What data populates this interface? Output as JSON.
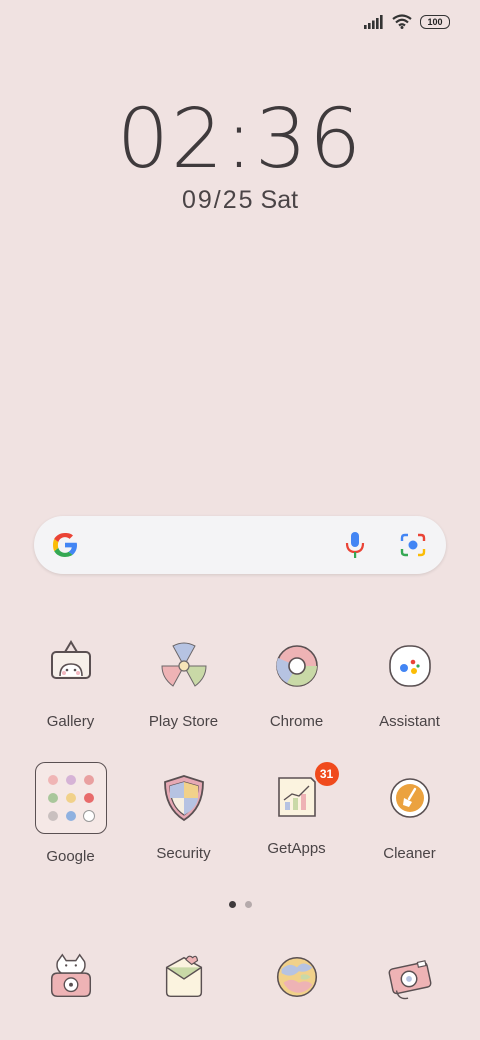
{
  "status_bar": {
    "battery": "100",
    "icons": [
      "signal-icon",
      "wifi-icon",
      "battery-icon"
    ]
  },
  "clock": {
    "time": "02:36",
    "date": "09/25",
    "weekday": "Sat"
  },
  "search": {
    "icons": [
      "google-g-icon",
      "mic-icon",
      "lens-icon"
    ]
  },
  "apps_row1": [
    {
      "label": "Gallery"
    },
    {
      "label": "Play Store"
    },
    {
      "label": "Chrome"
    },
    {
      "label": "Assistant"
    }
  ],
  "apps_row2": [
    {
      "label": "Google"
    },
    {
      "label": "Security"
    },
    {
      "label": "GetApps",
      "badge": "31"
    },
    {
      "label": "Cleaner"
    }
  ],
  "page_indicator": {
    "count": 2,
    "active": 1
  },
  "dock": [
    {
      "icon": "phone-icon"
    },
    {
      "icon": "messages-icon"
    },
    {
      "icon": "browser-icon"
    },
    {
      "icon": "camera-icon"
    }
  ],
  "colors": {
    "background": "#f0e2e1",
    "badge": "#f04a1c"
  }
}
